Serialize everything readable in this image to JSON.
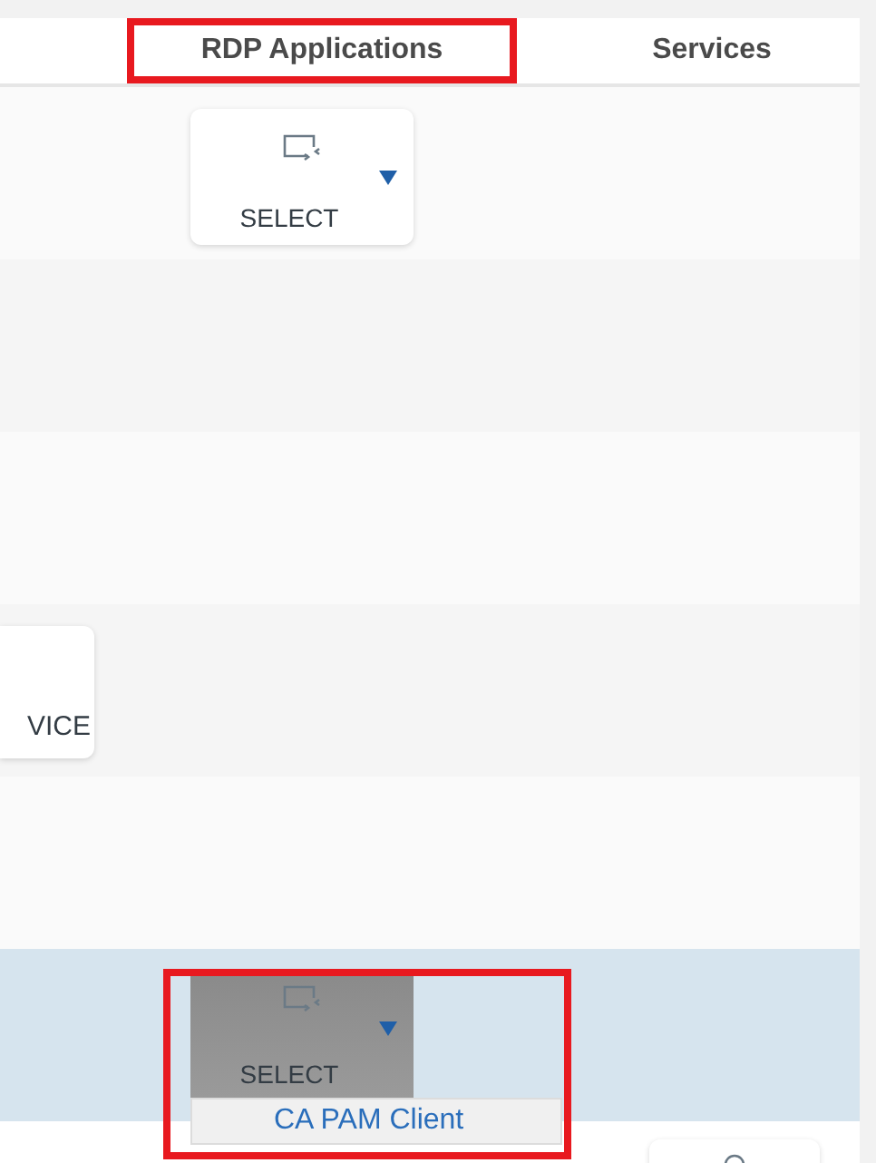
{
  "header": {
    "columns": [
      {
        "label": "RDP Applications",
        "annotated": true
      },
      {
        "label": "Services",
        "annotated": false
      }
    ]
  },
  "rows": [
    {
      "selected": false,
      "button": {
        "kind": "select",
        "label": "SELECT",
        "pressed": false
      }
    },
    {
      "selected": false
    },
    {
      "selected": false
    },
    {
      "selected": false,
      "button": {
        "kind": "partial",
        "label": "VICE"
      }
    },
    {
      "selected": false
    },
    {
      "selected": true,
      "button": {
        "kind": "select",
        "label": "SELECT",
        "pressed": true,
        "annotated": true,
        "menu": [
          "CA PAM Client"
        ]
      }
    }
  ]
}
